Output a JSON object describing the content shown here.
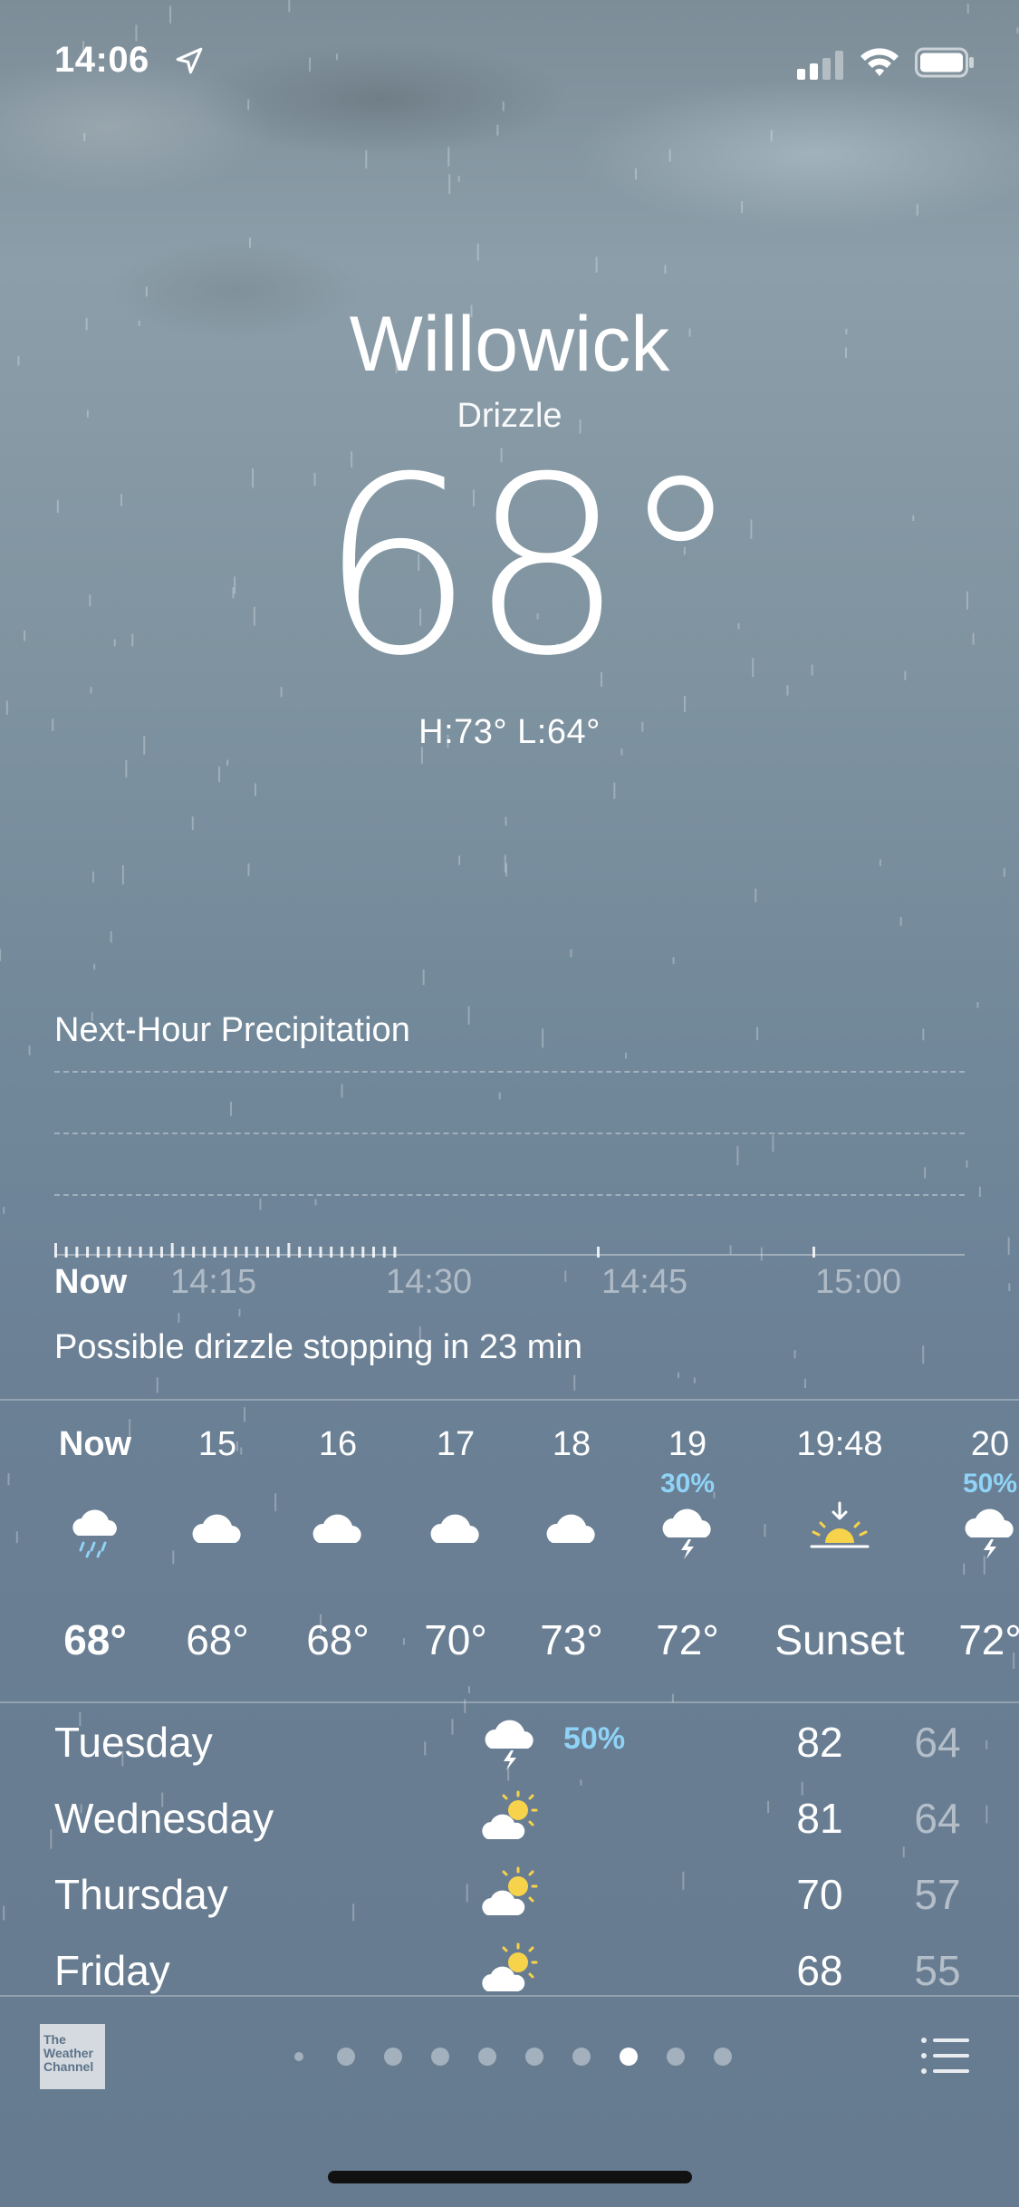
{
  "status_bar": {
    "time": "14:06",
    "location_icon": "location-arrow-icon",
    "signal_icon": "cellular-signal-icon",
    "wifi_icon": "wifi-icon",
    "battery_icon": "battery-icon"
  },
  "header": {
    "city": "Willowick",
    "condition": "Drizzle",
    "temperature": "68°",
    "high_low": "H:73°  L:64°"
  },
  "precipitation": {
    "title": "Next-Hour Precipitation",
    "time_labels": [
      "Now",
      "14:15",
      "14:30",
      "14:45",
      "15:00"
    ],
    "summary": "Possible drizzle stopping in 23 min"
  },
  "hourly": [
    {
      "label": "Now",
      "pop": "",
      "icon": "rain-cloud-icon",
      "temp": "68°"
    },
    {
      "label": "15",
      "pop": "",
      "icon": "cloud-icon",
      "temp": "68°"
    },
    {
      "label": "16",
      "pop": "",
      "icon": "cloud-icon",
      "temp": "68°"
    },
    {
      "label": "17",
      "pop": "",
      "icon": "cloud-icon",
      "temp": "70°"
    },
    {
      "label": "18",
      "pop": "",
      "icon": "cloud-icon",
      "temp": "73°"
    },
    {
      "label": "19",
      "pop": "30%",
      "icon": "thunderstorm-icon",
      "temp": "72°"
    },
    {
      "label": "19:48",
      "pop": "",
      "icon": "sunset-icon",
      "temp": "Sunset"
    },
    {
      "label": "20",
      "pop": "50%",
      "icon": "thunderstorm-icon",
      "temp": "72°"
    }
  ],
  "daily": [
    {
      "day": "Tuesday",
      "icon": "thunderstorm-icon",
      "pop": "50%",
      "high": "82",
      "low": "64"
    },
    {
      "day": "Wednesday",
      "icon": "partly-sunny-icon",
      "pop": "",
      "high": "81",
      "low": "64"
    },
    {
      "day": "Thursday",
      "icon": "partly-sunny-icon",
      "pop": "",
      "high": "70",
      "low": "57"
    },
    {
      "day": "Friday",
      "icon": "partly-sunny-icon",
      "pop": "",
      "high": "68",
      "low": "55"
    }
  ],
  "footer": {
    "logo_text": [
      "The",
      "Weather",
      "Channel"
    ],
    "page_count": 10,
    "current_page_index": 7,
    "list_icon": "list-icon"
  },
  "colors": {
    "precip_blue": "#8fd3f7",
    "sun_yellow": "#f6d34a"
  }
}
